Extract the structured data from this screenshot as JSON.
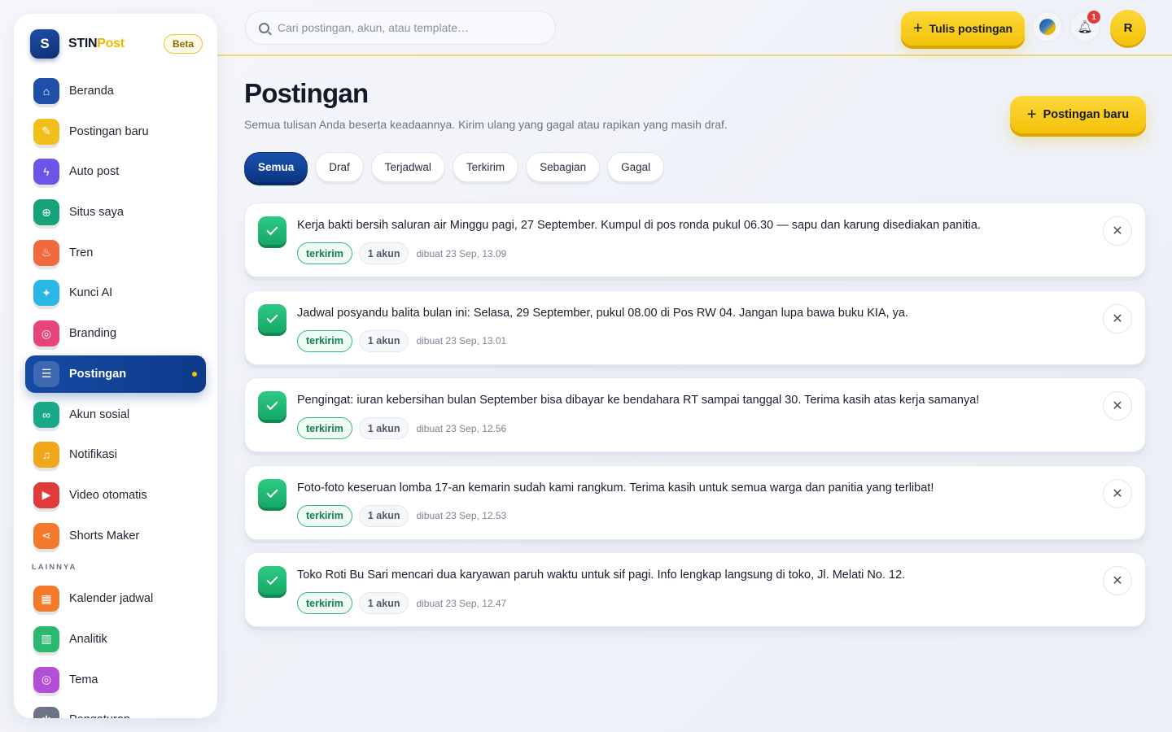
{
  "brand": {
    "logo_letter": "S",
    "name_main": "STIN",
    "name_accent": "Post",
    "badge": "Beta"
  },
  "sidebar": {
    "items": [
      {
        "label": "Beranda",
        "icon": "home-icon",
        "color": "#1f4fa8"
      },
      {
        "label": "Postingan baru",
        "icon": "pencil-icon",
        "color": "#f2bf1a"
      },
      {
        "label": "Auto post",
        "icon": "bolt-icon",
        "color": "#6a55e8"
      },
      {
        "label": "Situs saya",
        "icon": "globe-icon",
        "color": "#16a37a"
      },
      {
        "label": "Tren",
        "icon": "flame-icon",
        "color": "#f06a3d"
      },
      {
        "label": "Kunci AI",
        "icon": "sparkle-icon",
        "color": "#2bb7e6"
      },
      {
        "label": "Branding",
        "icon": "palette-icon",
        "color": "#e6447b"
      },
      {
        "label": "Postingan",
        "icon": "list-icon",
        "color": "#154aa3",
        "active": true
      },
      {
        "label": "Akun sosial",
        "icon": "link-icon",
        "color": "#1aa88a"
      },
      {
        "label": "Notifikasi",
        "icon": "bell-icon",
        "color": "#f0a81a"
      },
      {
        "label": "Video otomatis",
        "icon": "video-icon",
        "color": "#e03a3a"
      },
      {
        "label": "Shorts Maker",
        "icon": "share-icon",
        "color": "#f27a2a"
      }
    ],
    "section_label": "LAINNYA",
    "more_items": [
      {
        "label": "Kalender jadwal",
        "icon": "calendar-icon",
        "color": "#f27a2a"
      },
      {
        "label": "Analitik",
        "icon": "chart-icon",
        "color": "#2bb870"
      },
      {
        "label": "Tema",
        "icon": "palette-icon",
        "color": "#b34fd6"
      },
      {
        "label": "Pengaturan",
        "icon": "gear-icon",
        "color": "#6b7385"
      }
    ]
  },
  "topbar": {
    "search_placeholder": "Cari postingan, akun, atau template…",
    "write_label": "Tulis postingan",
    "notification_count": "1",
    "avatar_letter": "R"
  },
  "page": {
    "title": "Postingan",
    "subtitle": "Semua tulisan Anda beserta keadaannya. Kirim ulang yang gagal atau rapikan yang masih draf.",
    "new_button": "Postingan baru"
  },
  "filters": [
    "Semua",
    "Draf",
    "Terjadwal",
    "Terkirim",
    "Sebagian",
    "Gagal"
  ],
  "active_filter": "Semua",
  "posts": [
    {
      "text": "Kerja bakti bersih saluran air Minggu pagi, 27 September. Kumpul di pos ronda pukul 06.30 — sapu dan karung disediakan panitia.",
      "status": "terkirim",
      "accounts": "1 akun",
      "created": "dibuat 23 Sep, 13.09"
    },
    {
      "text": "Jadwal posyandu balita bulan ini: Selasa, 29 September, pukul 08.00 di Pos RW 04. Jangan lupa bawa buku KIA, ya.",
      "status": "terkirim",
      "accounts": "1 akun",
      "created": "dibuat 23 Sep, 13.01"
    },
    {
      "text": "Pengingat: iuran kebersihan bulan September bisa dibayar ke bendahara RT sampai tanggal 30. Terima kasih atas kerja samanya!",
      "status": "terkirim",
      "accounts": "1 akun",
      "created": "dibuat 23 Sep, 12.56"
    },
    {
      "text": "Foto-foto keseruan lomba 17-an kemarin sudah kami rangkum. Terima kasih untuk semua warga dan panitia yang terlibat!",
      "status": "terkirim",
      "accounts": "1 akun",
      "created": "dibuat 23 Sep, 12.53"
    },
    {
      "text": "Toko Roti Bu Sari mencari dua karyawan paruh waktu untuk sif pagi. Info lengkap langsung di toko, Jl. Melati No. 12.",
      "status": "terkirim",
      "accounts": "1 akun",
      "created": "dibuat 23 Sep, 12.47"
    }
  ]
}
